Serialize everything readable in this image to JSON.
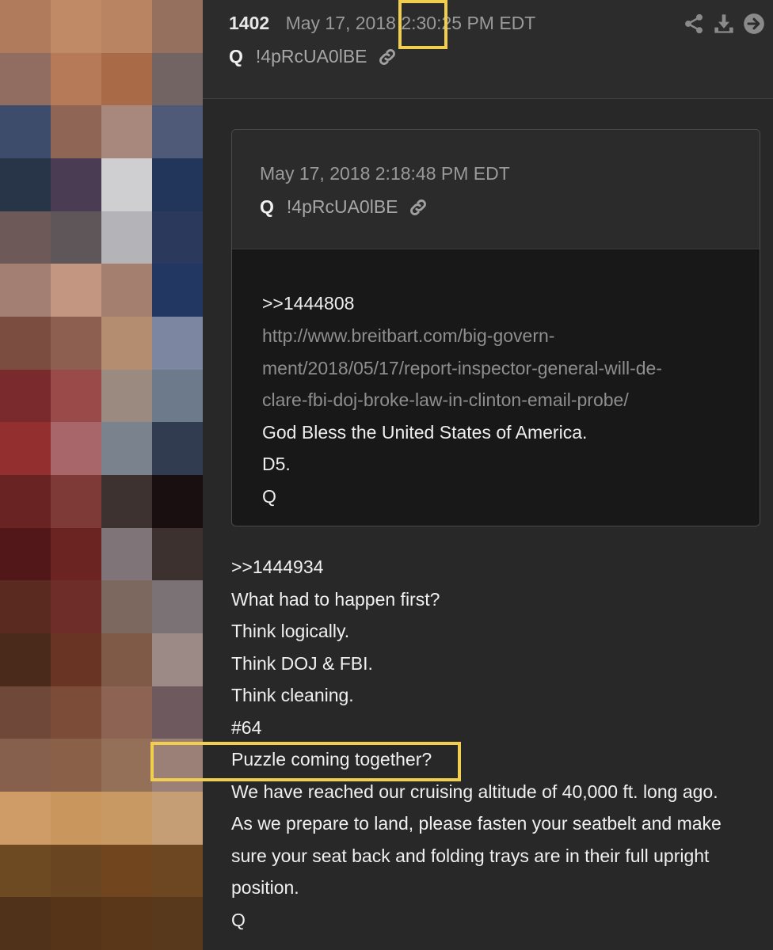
{
  "post": {
    "number": "1402",
    "datetime": "May 17, 2018 2:30:25 PM EDT",
    "author": "Q",
    "tripcode": "!4pRcUA0lBE",
    "header_icons": [
      "share-icon",
      "download-icon",
      "arrow-circle-icon"
    ]
  },
  "quoted_post": {
    "datetime": "May 17, 2018 2:18:48 PM EDT",
    "author": "Q",
    "tripcode": "!4pRcUA0lBE",
    "lines": [
      ">>1444808",
      "http://www.breitbart.com/big-govern-",
      "ment/2018/05/17/report-inspector-general-will-de-",
      "clare-fbi-doj-broke-law-in-clinton-email-probe/",
      "God Bless the United States of America.",
      "D5.",
      "Q"
    ]
  },
  "body_lines": [
    ">>1444934",
    "What had to happen first?",
    "Think logically.",
    "Think DOJ & FBI.",
    "Think cleaning.",
    "#64",
    "Puzzle coming together?",
    "We have reached our cruising altitude of 40,000 ft. long ago.",
    "As we prepare to land, please fasten your seatbelt and make",
    "sure your seat back and folding trays are in their full upright",
    "position.",
    "Q"
  ],
  "colors": {
    "highlight": "#f2ce4e",
    "background": "#282828",
    "url_text": "#8e8e8e"
  }
}
